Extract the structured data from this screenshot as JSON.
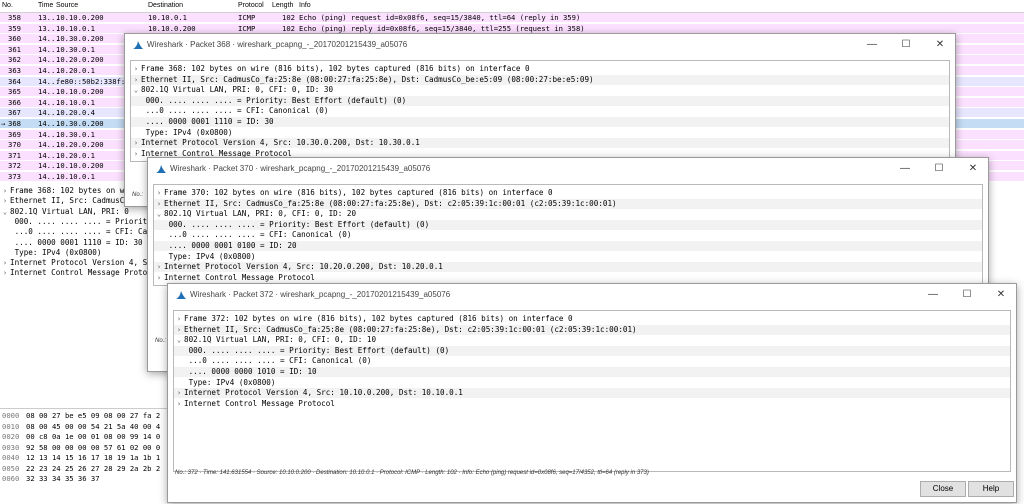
{
  "packet_list": {
    "columns": [
      "No.",
      "Time",
      "Source",
      "Destination",
      "Protocol",
      "Length",
      "Info"
    ],
    "rows": [
      {
        "no": "358",
        "time": "13...",
        "src": "10.10.0.200",
        "dst": "10.10.0.1",
        "proto": "ICMP",
        "len": "102",
        "info": "Echo (ping) request  id=0x08f6, seq=15/3840, ttl=64 (reply in 359)",
        "style": "pk"
      },
      {
        "no": "359",
        "time": "13...",
        "src": "10.10.0.1",
        "dst": "10.10.0.200",
        "proto": "ICMP",
        "len": "102",
        "info": "Echo (ping) reply    id=0x08f6, seq=15/3840, ttl=255 (request in 358)",
        "style": "pk"
      },
      {
        "no": "360",
        "time": "14...",
        "src": "10.30.0.200",
        "dst": "",
        "proto": "",
        "len": "",
        "info": "",
        "style": "pk"
      },
      {
        "no": "361",
        "time": "14...",
        "src": "10.30.0.1",
        "dst": "",
        "proto": "",
        "len": "",
        "info": "",
        "style": "pk"
      },
      {
        "no": "362",
        "time": "14...",
        "src": "10.20.0.200",
        "dst": "",
        "proto": "",
        "len": "",
        "info": "",
        "style": "pk"
      },
      {
        "no": "363",
        "time": "14...",
        "src": "10.20.0.1",
        "dst": "",
        "proto": "",
        "len": "",
        "info": "",
        "style": "pk"
      },
      {
        "no": "364",
        "time": "14...",
        "src": "fe80::50b2:338f:",
        "dst": "",
        "proto": "",
        "len": "",
        "info": "",
        "style": "bl"
      },
      {
        "no": "365",
        "time": "14...",
        "src": "10.10.0.200",
        "dst": "",
        "proto": "",
        "len": "",
        "info": "",
        "style": "pk"
      },
      {
        "no": "366",
        "time": "14...",
        "src": "10.10.0.1",
        "dst": "",
        "proto": "",
        "len": "",
        "info": "",
        "style": "pk"
      },
      {
        "no": "367",
        "time": "14...",
        "src": "10.20.0.4",
        "dst": "",
        "proto": "",
        "len": "",
        "info": "",
        "style": "bl"
      },
      {
        "no": "368",
        "time": "14...",
        "src": "10.30.0.200",
        "dst": "",
        "proto": "",
        "len": "",
        "info": "",
        "style": "sel"
      },
      {
        "no": "369",
        "time": "14...",
        "src": "10.30.0.1",
        "dst": "",
        "proto": "",
        "len": "",
        "info": "",
        "style": "pk"
      },
      {
        "no": "370",
        "time": "14...",
        "src": "10.20.0.200",
        "dst": "",
        "proto": "",
        "len": "",
        "info": "",
        "style": "pk"
      },
      {
        "no": "371",
        "time": "14...",
        "src": "10.20.0.1",
        "dst": "",
        "proto": "",
        "len": "",
        "info": "",
        "style": "pk"
      },
      {
        "no": "372",
        "time": "14...",
        "src": "10.10.0.200",
        "dst": "",
        "proto": "",
        "len": "",
        "info": "",
        "style": "pk"
      },
      {
        "no": "373",
        "time": "14...",
        "src": "10.10.0.1",
        "dst": "",
        "proto": "",
        "len": "",
        "info": "",
        "style": "pk"
      }
    ]
  },
  "bg_detail": [
    {
      "exp": ">",
      "text": "Frame 368: 102 bytes on wire"
    },
    {
      "exp": ">",
      "text": "Ethernet II, Src: CadmusCo_"
    },
    {
      "exp": "v",
      "text": "802.1Q Virtual LAN, PRI: 0"
    },
    {
      "exp": "",
      "text": "   000. .... .... .... = Priorit"
    },
    {
      "exp": "",
      "text": "   ...0 .... .... .... = CFI: Ca"
    },
    {
      "exp": "",
      "text": "   .... 0000 0001 1110 = ID: 30"
    },
    {
      "exp": "",
      "text": "   Type: IPv4 (0x0800)"
    },
    {
      "exp": ">",
      "text": "Internet Protocol Version 4, Sr"
    },
    {
      "exp": ">",
      "text": "Internet Control Message Protoc"
    }
  ],
  "bg_bytes": [
    {
      "off": "0000",
      "hex": "08 00 27 be e5 09 08 00  27 fa 2"
    },
    {
      "off": "0010",
      "hex": "08 00 45 00 00 54 21 5a  40 00 4"
    },
    {
      "off": "0020",
      "hex": "00 c8 0a 1e 00 01 08 00  99 14 0"
    },
    {
      "off": "0030",
      "hex": "92 58 00 00 00 00 57 61  02 00 0"
    },
    {
      "off": "0040",
      "hex": "12 13 14 15 16 17 18 19  1a 1b 1"
    },
    {
      "off": "0050",
      "hex": "22 23 24 25 26 27 28 29  2a 2b 2"
    },
    {
      "off": "0060",
      "hex": "32 33 34 35 36 37"
    }
  ],
  "windows": [
    {
      "title": "Wireshark · Packet 368 · wireshark_pcapng_-_20170201215439_a05076",
      "lines": [
        {
          "exp": ">",
          "text": "Frame 368: 102 bytes on wire (816 bits), 102 bytes captured (816 bits) on interface 0"
        },
        {
          "exp": ">",
          "text": "Ethernet II, Src: CadmusCo_fa:25:8e (08:00:27:fa:25:8e), Dst: CadmusCo_be:e5:09 (08:00:27:be:e5:09)"
        },
        {
          "exp": "v",
          "text": "802.1Q Virtual LAN, PRI: 0, CFI: 0, ID: 30"
        },
        {
          "exp": "",
          "text": "    000. .... .... .... = Priority: Best Effort (default) (0)"
        },
        {
          "exp": "",
          "text": "    ...0 .... .... .... = CFI: Canonical (0)"
        },
        {
          "exp": "",
          "text": "    .... 0000 0001 1110 = ID: 30"
        },
        {
          "exp": "",
          "text": "    Type: IPv4 (0x0800)"
        },
        {
          "exp": ">",
          "text": "Internet Protocol Version 4, Src: 10.30.0.200, Dst: 10.30.0.1"
        },
        {
          "exp": ">",
          "text": "Internet Control Message Protocol"
        }
      ],
      "status": "No.:"
    },
    {
      "title": "Wireshark · Packet 370 · wireshark_pcapng_-_20170201215439_a05076",
      "lines": [
        {
          "exp": ">",
          "text": "Frame 370: 102 bytes on wire (816 bits), 102 bytes captured (816 bits) on interface 0"
        },
        {
          "exp": ">",
          "text": "Ethernet II, Src: CadmusCo_fa:25:8e (08:00:27:fa:25:8e), Dst: c2:05:39:1c:00:01 (c2:05:39:1c:00:01)"
        },
        {
          "exp": "v",
          "text": "802.1Q Virtual LAN, PRI: 0, CFI: 0, ID: 20"
        },
        {
          "exp": "",
          "text": "    000. .... .... .... = Priority: Best Effort (default) (0)"
        },
        {
          "exp": "",
          "text": "    ...0 .... .... .... = CFI: Canonical (0)"
        },
        {
          "exp": "",
          "text": "    .... 0000 0001 0100 = ID: 20"
        },
        {
          "exp": "",
          "text": "    Type: IPv4 (0x0800)"
        },
        {
          "exp": ">",
          "text": "Internet Protocol Version 4, Src: 10.20.0.200, Dst: 10.20.0.1"
        },
        {
          "exp": ">",
          "text": "Internet Control Message Protocol"
        }
      ],
      "status": "No.:"
    },
    {
      "title": "Wireshark · Packet 372 · wireshark_pcapng_-_20170201215439_a05076",
      "lines": [
        {
          "exp": ">",
          "text": "Frame 372: 102 bytes on wire (816 bits), 102 bytes captured (816 bits) on interface 0"
        },
        {
          "exp": ">",
          "text": "Ethernet II, Src: CadmusCo_fa:25:8e (08:00:27:fa:25:8e), Dst: c2:05:39:1c:00:01 (c2:05:39:1c:00:01)"
        },
        {
          "exp": "v",
          "text": "802.1Q Virtual LAN, PRI: 0, CFI: 0, ID: 10"
        },
        {
          "exp": "",
          "text": "    000. .... .... .... = Priority: Best Effort (default) (0)"
        },
        {
          "exp": "",
          "text": "    ...0 .... .... .... = CFI: Canonical (0)"
        },
        {
          "exp": "",
          "text": "    .... 0000 0000 1010 = ID: 10"
        },
        {
          "exp": "",
          "text": "    Type: IPv4 (0x0800)"
        },
        {
          "exp": ">",
          "text": "Internet Protocol Version 4, Src: 10.10.0.200, Dst: 10.10.0.1"
        },
        {
          "exp": ">",
          "text": "Internet Control Message Protocol"
        }
      ],
      "status": "No.: 372 · Time: 141.631554 · Source: 10.10.0.200 · Destination: 10.10.0.1 · Protocol: ICMP · Length: 102 · Info: Echo (ping) request id=0x08f6, seq=17/4352, ttl=64 (reply in 373)",
      "close_label": "Close",
      "help_label": "Help"
    }
  ],
  "window_controls": {
    "minimize": "—",
    "maximize": "☐",
    "close": "✕"
  },
  "colors": {
    "pink_row": "#fce0ff",
    "blue_row": "#e7e6ff",
    "selected_row": "#c4dcf4",
    "fin": "#1f6fb4"
  }
}
